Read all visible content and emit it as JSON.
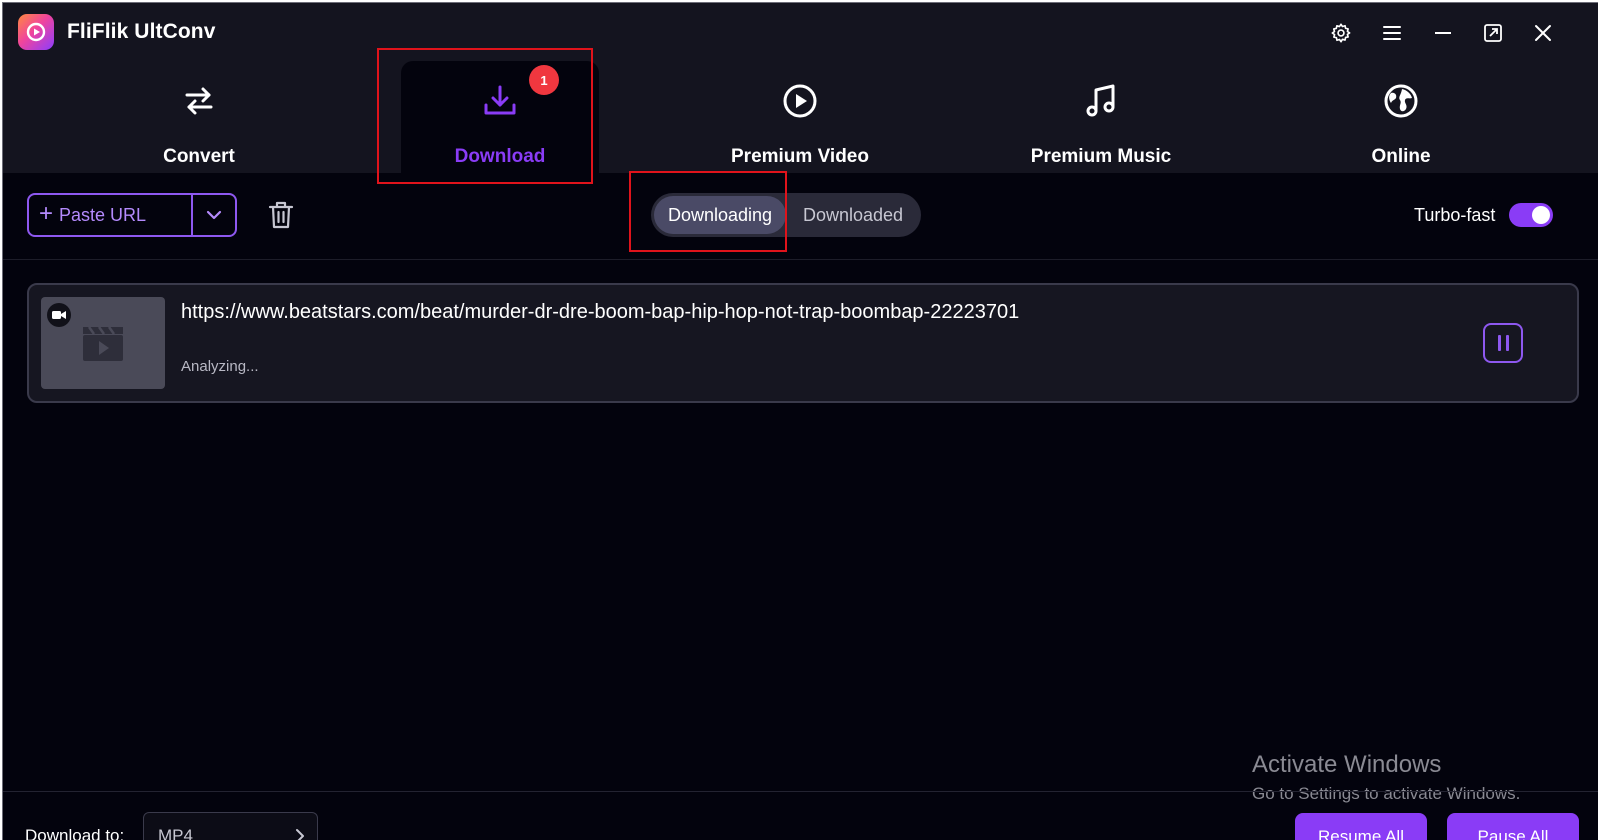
{
  "app": {
    "title": "FliFlik UltConv"
  },
  "window_controls": [
    "gear-icon",
    "menu-icon",
    "minimize-icon",
    "maximize-icon",
    "close-icon"
  ],
  "nav": {
    "tabs": [
      {
        "label": "Convert",
        "icon": "convert-icon"
      },
      {
        "label": "Download",
        "icon": "download-icon",
        "badge": "1",
        "active": true
      },
      {
        "label": "Premium Video",
        "icon": "play-circle-icon"
      },
      {
        "label": "Premium Music",
        "icon": "music-note-icon"
      },
      {
        "label": "Online",
        "icon": "globe-icon"
      }
    ]
  },
  "toolbar": {
    "paste_url": "Paste URL",
    "segments": {
      "downloading": "Downloading",
      "downloaded": "Downloaded",
      "active": "downloading"
    },
    "turbo_label": "Turbo-fast",
    "turbo_on": true
  },
  "items": [
    {
      "url": "https://www.beatstars.com/beat/murder-dr-dre-boom-bap-hip-hop-not-trap-boombap-22223701",
      "status": "Analyzing..."
    }
  ],
  "watermark": {
    "title": "Activate Windows",
    "subtitle": "Go to Settings to activate Windows."
  },
  "footer": {
    "download_to_label": "Download to:",
    "format": "MP4",
    "resume_all": "Resume All",
    "pause_all": "Pause All"
  },
  "colors": {
    "accent": "#8a3cf6",
    "background": "#03030d",
    "header": "#14141f",
    "highlight": "#e0131b",
    "badge": "#f0373f"
  }
}
